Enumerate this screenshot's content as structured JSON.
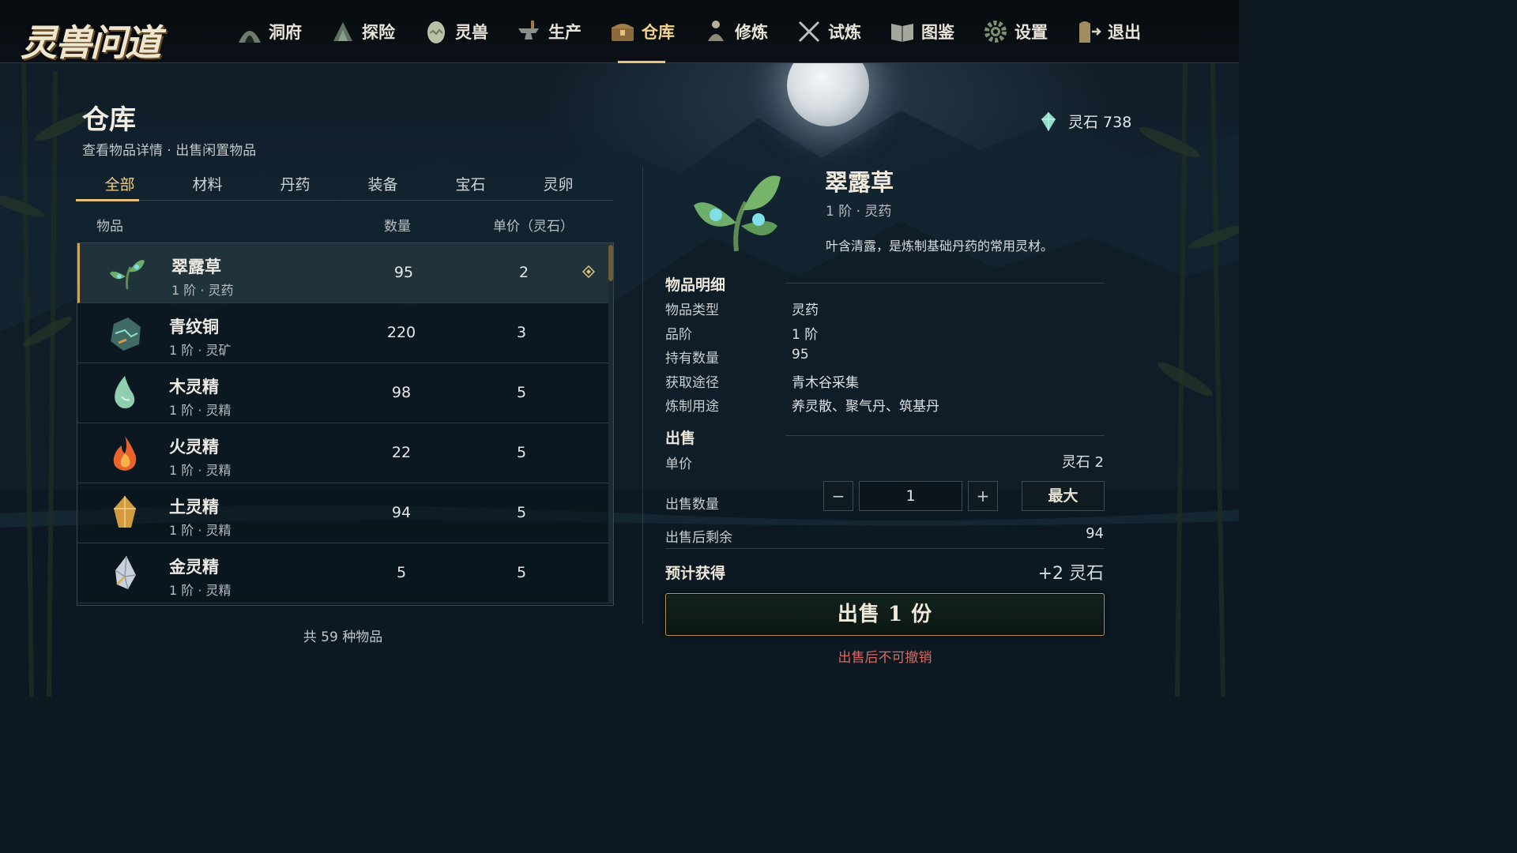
{
  "app": {
    "logo_text": "灵兽问道"
  },
  "nav": {
    "items": [
      {
        "label": "洞府",
        "icon": "cave-icon"
      },
      {
        "label": "探险",
        "icon": "compass-icon"
      },
      {
        "label": "灵兽",
        "icon": "egg-icon"
      },
      {
        "label": "生产",
        "icon": "anvil-icon"
      },
      {
        "label": "仓库",
        "icon": "chest-icon",
        "active": true
      },
      {
        "label": "修炼",
        "icon": "meditation-icon"
      },
      {
        "label": "试炼",
        "icon": "crossed-swords-icon"
      },
      {
        "label": "图鉴",
        "icon": "book-icon"
      },
      {
        "label": "设置",
        "icon": "gear-icon"
      },
      {
        "label": "退出",
        "icon": "exit-door-icon"
      }
    ]
  },
  "warehouse": {
    "title": "仓库",
    "subtitle": "查看物品详情 · 出售闲置物品",
    "tabs": [
      {
        "label": "全部",
        "active": true
      },
      {
        "label": "材料"
      },
      {
        "label": "丹药"
      },
      {
        "label": "装备"
      },
      {
        "label": "宝石"
      },
      {
        "label": "灵卵"
      }
    ],
    "columns": {
      "item": "物品",
      "qty": "数量",
      "price": "单价（灵石）"
    },
    "items": [
      {
        "name": "翠露草",
        "tier": "1 阶 · 灵药",
        "qty": "95",
        "price": "2",
        "icon": "herb-icon",
        "selected": true
      },
      {
        "name": "青纹铜",
        "tier": "1 阶 · 灵矿",
        "qty": "220",
        "price": "3",
        "icon": "ore-icon"
      },
      {
        "name": "木灵精",
        "tier": "1 阶 · 灵精",
        "qty": "98",
        "price": "5",
        "icon": "wood-essence-icon"
      },
      {
        "name": "火灵精",
        "tier": "1 阶 · 灵精",
        "qty": "22",
        "price": "5",
        "icon": "fire-essence-icon"
      },
      {
        "name": "土灵精",
        "tier": "1 阶 · 灵精",
        "qty": "94",
        "price": "5",
        "icon": "earth-essence-icon"
      },
      {
        "name": "金灵精",
        "tier": "1 阶 · 灵精",
        "qty": "5",
        "price": "5",
        "icon": "metal-essence-icon"
      }
    ],
    "total": "共 59 种物品"
  },
  "currency": {
    "label": "灵石 738",
    "icon": "spirit-stone-icon"
  },
  "detail": {
    "name": "翠露草",
    "tier": "1 阶 · 灵药",
    "desc": "叶含清露，是炼制基础丹药的常用灵材。",
    "section_title": "物品明细",
    "fields": [
      {
        "label": "物品类型",
        "value": "灵药"
      },
      {
        "label": "品阶",
        "value": "1 阶"
      },
      {
        "label": "持有数量",
        "value": "95"
      },
      {
        "label": "获取途径",
        "value": "青木谷采集"
      },
      {
        "label": "炼制用途",
        "value": "养灵散、聚气丹、筑基丹"
      }
    ]
  },
  "sell": {
    "section_title": "出售",
    "unit_price_label": "单价",
    "unit_price_value": "灵石 2",
    "qty_label": "出售数量",
    "minus": "−",
    "qty_value": "1",
    "plus": "+",
    "max_label": "最大",
    "remain_label": "出售后剩余",
    "remain_value": "94",
    "gain_label": "预计获得",
    "gain_value": "+2 灵石",
    "button_label": "出售 1 份",
    "warning": "出售后不可撤销"
  },
  "colors": {
    "accent_gold": "#e6c27a",
    "warning_red": "#d9685e",
    "panel_dark": "#0d1820"
  }
}
